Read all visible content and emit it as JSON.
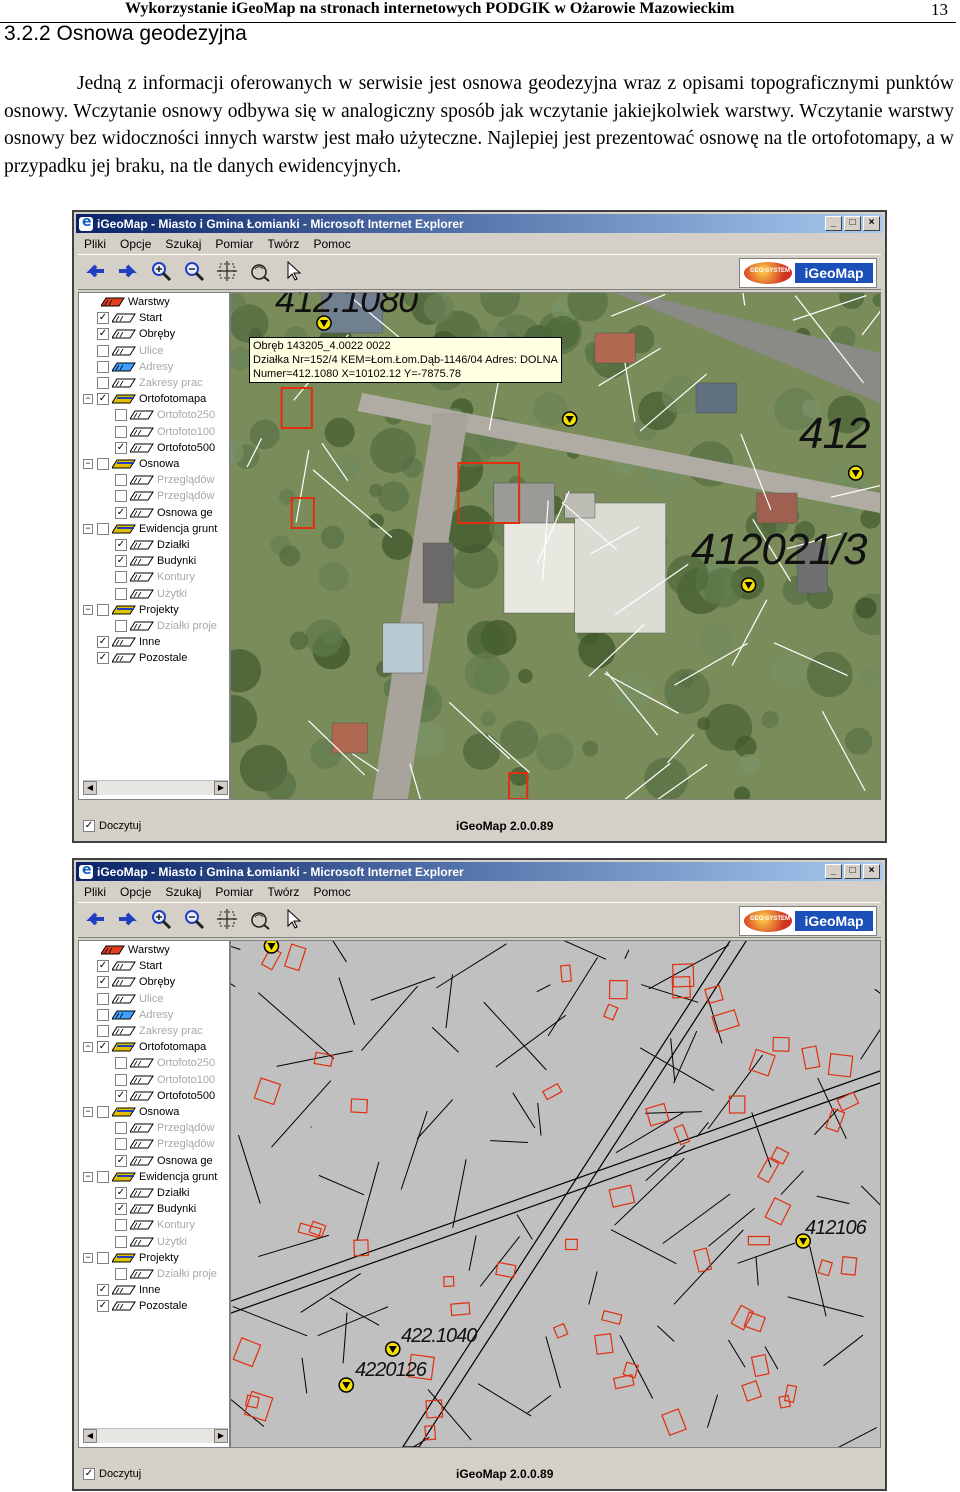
{
  "header": {
    "title": "Wykorzystanie iGeoMap na stronach internetowych PODGIK w Ożarowie Mazowieckim",
    "page_number": "13"
  },
  "section": {
    "heading": "3.2.2 Osnowa geodezyjna",
    "paragraph": "Jedną z informacji oferowanych w serwisie jest osnowa geodezyjna wraz z opisami topograficznymi punktów osnowy. Wczytanie osnowy odbywa się w analogiczny sposób jak wczytanie jakiejkolwiek warstwy. Wczytanie warstwy osnowy bez widoczności innych warstw jest mało użyteczne. Najlepiej jest prezentować osnowę na tle ortofotomapy, a w przypadku jej braku, na tle danych ewidencyjnych."
  },
  "window": {
    "title": "iGeoMap - Miasto i Gmina Łomianki - Microsoft Internet Explorer",
    "menu": [
      "Pliki",
      "Opcje",
      "Szukaj",
      "Pomiar",
      "Twórz",
      "Pomoc"
    ],
    "logo_text": "iGeoMap",
    "logo_company": "GEO-SYSTEM",
    "status_checkbox": "Doczytuj",
    "version": "iGeoMap 2.0.0.89",
    "toolbar_icons": [
      "arrow-left-icon",
      "arrow-right-icon",
      "zoom-in-icon",
      "zoom-out-icon",
      "zoom-extent-icon",
      "info-icon",
      "pointer-icon"
    ],
    "layers": [
      {
        "label": "Warstwy",
        "indent": 0,
        "checked": null,
        "dim": false,
        "expander": null
      },
      {
        "label": "Start",
        "indent": 1,
        "checked": true,
        "dim": false,
        "expander": null
      },
      {
        "label": "Obręby",
        "indent": 1,
        "checked": true,
        "dim": false,
        "expander": null
      },
      {
        "label": "Ulice",
        "indent": 1,
        "checked": false,
        "dim": true,
        "expander": null
      },
      {
        "label": "Adresy",
        "indent": 1,
        "checked": false,
        "dim": true,
        "expander": null
      },
      {
        "label": "Zakresy prac",
        "indent": 1,
        "checked": false,
        "dim": true,
        "expander": null
      },
      {
        "label": "Ortofotomapa",
        "indent": 0,
        "checked": true,
        "dim": false,
        "expander": "−"
      },
      {
        "label": "Ortofoto250",
        "indent": 2,
        "checked": false,
        "dim": true,
        "expander": null
      },
      {
        "label": "Ortofoto100",
        "indent": 2,
        "checked": false,
        "dim": true,
        "expander": null
      },
      {
        "label": "Ortofoto500",
        "indent": 2,
        "checked": true,
        "dim": false,
        "expander": null
      },
      {
        "label": "Osnowa",
        "indent": 0,
        "checked": false,
        "dim": false,
        "expander": "−"
      },
      {
        "label": "Przeglądów",
        "indent": 2,
        "checked": false,
        "dim": true,
        "expander": null
      },
      {
        "label": "Przeglądów",
        "indent": 2,
        "checked": false,
        "dim": true,
        "expander": null
      },
      {
        "label": "Osnowa ge",
        "indent": 2,
        "checked": true,
        "dim": false,
        "expander": null
      },
      {
        "label": "Ewidencja grunt",
        "indent": 0,
        "checked": false,
        "dim": false,
        "expander": "−"
      },
      {
        "label": "Działki",
        "indent": 2,
        "checked": true,
        "dim": false,
        "expander": null
      },
      {
        "label": "Budynki",
        "indent": 2,
        "checked": true,
        "dim": false,
        "expander": null
      },
      {
        "label": "Kontury",
        "indent": 2,
        "checked": false,
        "dim": true,
        "expander": null
      },
      {
        "label": "Użytki",
        "indent": 2,
        "checked": false,
        "dim": true,
        "expander": null
      },
      {
        "label": "Projekty",
        "indent": 0,
        "checked": false,
        "dim": false,
        "expander": "−"
      },
      {
        "label": "Działki proje",
        "indent": 2,
        "checked": false,
        "dim": true,
        "expander": null
      },
      {
        "label": "Inne",
        "indent": 1,
        "checked": true,
        "dim": false,
        "expander": null
      },
      {
        "label": "Pozostale",
        "indent": 1,
        "checked": true,
        "dim": false,
        "expander": null
      }
    ]
  },
  "screenshot1": {
    "tooltip": [
      "Obręb 143205_4.0022 0022",
      "Działka Nr=152/4 KEM=Łom.Łom.Dąb-1146/04 Adres: DOLNA",
      "Numer=412.1080 X=10102.12 Y=-7875.78"
    ],
    "labels": [
      "412.1080",
      "412",
      "412021/3"
    ]
  },
  "screenshot2": {
    "labels": [
      "412106",
      "422.1040",
      "4220126"
    ]
  },
  "colors": {
    "titlebar_start": "#0a246a",
    "titlebar_end": "#a6caf0",
    "parcel_lines": "#ffffff",
    "building_outline": "#e03010",
    "cadastral_bg": "#c0c0c0",
    "ortho_bg": "#7a8c5a"
  }
}
